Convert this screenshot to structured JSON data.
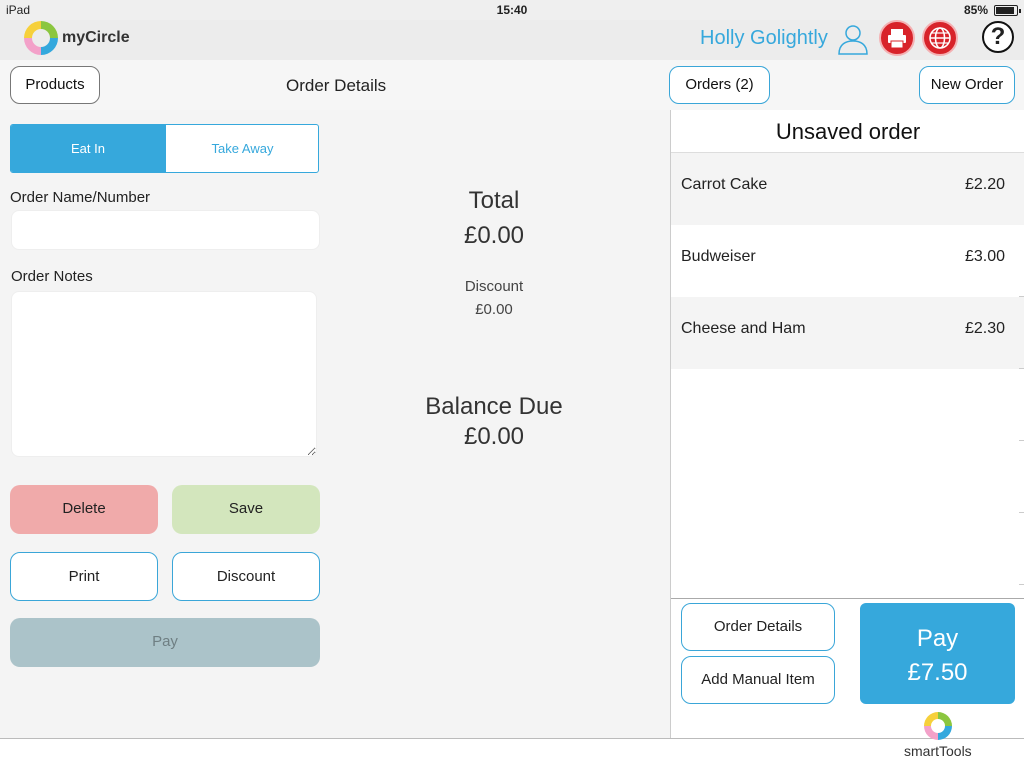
{
  "status_bar": {
    "device": "iPad",
    "time": "15:40",
    "battery": "85%"
  },
  "app": {
    "logo_text": "myCircle",
    "username": "Holly Golightly",
    "help_label": "?"
  },
  "toolbar": {
    "products_label": "Products",
    "page_title": "Order Details",
    "orders_label": "Orders (2)",
    "new_order_label": "New Order"
  },
  "order_type": {
    "eat_in": "Eat In",
    "take_away": "Take Away",
    "selected": "Eat In"
  },
  "form": {
    "name_label": "Order Name/Number",
    "name_value": "",
    "notes_label": "Order Notes",
    "notes_value": ""
  },
  "actions": {
    "delete": "Delete",
    "save": "Save",
    "print": "Print",
    "discount": "Discount",
    "pay": "Pay"
  },
  "totals": {
    "total_label": "Total",
    "total_value": "£0.00",
    "discount_label": "Discount",
    "discount_value": "£0.00",
    "balance_label": "Balance Due",
    "balance_value": "£0.00"
  },
  "order": {
    "title": "Unsaved order",
    "items": [
      {
        "name": "Carrot Cake",
        "price": "£2.20"
      },
      {
        "name": "Budweiser",
        "price": "£3.00"
      },
      {
        "name": "Cheese and Ham",
        "price": "£2.30"
      }
    ],
    "order_details_label": "Order Details",
    "add_manual_label": "Add Manual Item",
    "pay_label": "Pay",
    "pay_value": "£7.50"
  },
  "bottom": {
    "smarttools_label": "smartTools"
  },
  "colors": {
    "accent": "#36a8dc",
    "delete": "#f0aaaa",
    "save": "#d3e6bd",
    "disabled_pay": "#abc3c9",
    "header_icons": "#d8232a"
  }
}
